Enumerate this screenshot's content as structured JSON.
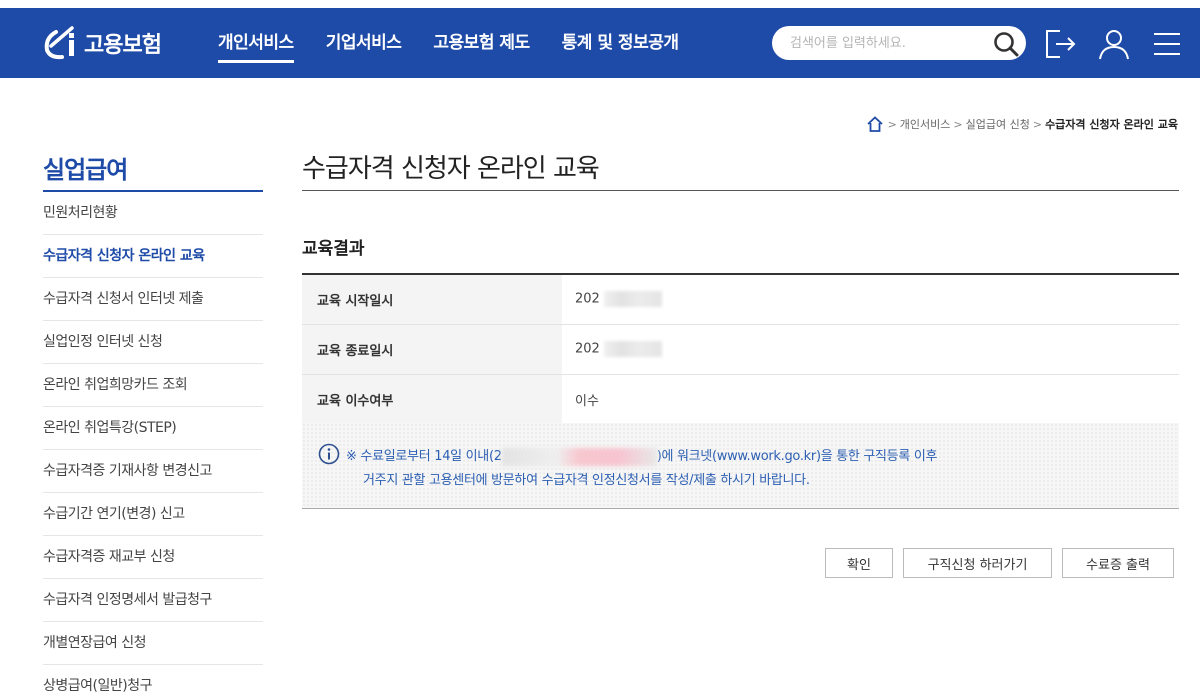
{
  "header": {
    "logo_text": "고용보험",
    "nav": [
      "개인서비스",
      "기업서비스",
      "고용보험 제도",
      "통계 및 정보공개"
    ],
    "search_placeholder": "검색어를 입력하세요.",
    "icons": [
      "search-icon",
      "logout-icon",
      "user-icon",
      "menu-icon"
    ],
    "brand_color": "#1e4aa8"
  },
  "breadcrumb": {
    "items": [
      "개인서비스",
      "실업급여 신청"
    ],
    "current": "수급자격 신청자 온라인 교육"
  },
  "sidebar": {
    "title": "실업급여",
    "items": [
      "민원처리현황",
      "수급자격 신청자 온라인 교육",
      "수급자격 신청서 인터넷 제출",
      "실업인정 인터넷 신청",
      "온라인 취업희망카드 조회",
      "온라인 취업특강(STEP)",
      "수급자격증 기재사항 변경신고",
      "수급기간 연기(변경) 신고",
      "수급자격증 재교부 신청",
      "수급자격 인정명세서 발급청구",
      "개별연장급여 신청",
      "상병급여(일반)청구"
    ],
    "active_index": 1
  },
  "main": {
    "title": "수급자격 신청자 온라인 교육",
    "section_title": "교육결과",
    "rows": [
      {
        "label": "교육 시작일시",
        "value": "202"
      },
      {
        "label": "교육 종료일시",
        "value": "202"
      },
      {
        "label": "교육 이수여부",
        "value": "이수"
      }
    ],
    "notice": {
      "line1_prefix": "※ 수료일로부터 14일 이내(2",
      "line1_suffix": ")에 워크넷(www.work.go.kr)을 통한 구직등록 이후",
      "line2": "거주지 관할 고용센터에 방문하여 수급자격 인정신청서를 작성/제출 하시기 바랍니다."
    },
    "buttons": {
      "confirm": "확인",
      "job_search": "구직신청 하러가기",
      "certificate": "수료증 출력"
    }
  }
}
